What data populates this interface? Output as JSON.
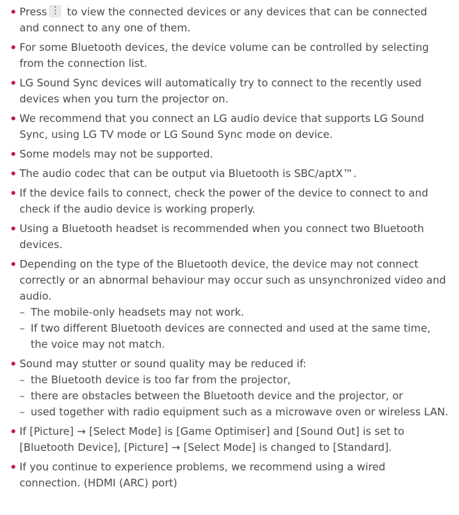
{
  "items": [
    {
      "pre": "Press",
      "icon": "more-vertical-icon",
      "post": " to view the connected devices or any devices that can be connected and connect to any one of them."
    },
    {
      "text": "For some Bluetooth devices, the device volume can be controlled by selecting from the connection list."
    },
    {
      "text": "LG Sound Sync devices will automatically try to connect to the recently used devices when you turn the projector on."
    },
    {
      "text": "We recommend that you connect an LG audio device that supports LG Sound Sync, using LG TV mode or LG Sound Sync mode on device."
    },
    {
      "text": "Some models may not be supported."
    },
    {
      "text": "The audio codec that can be output via Bluetooth is SBC/aptX™."
    },
    {
      "text": "If the device fails to connect, check the power of the device to connect to and check if the audio device is working properly."
    },
    {
      "text": "Using a Bluetooth headset is recommended when you connect two Bluetooth devices."
    },
    {
      "text": "Depending on the type of the Bluetooth device, the device may not connect correctly or an abnormal behaviour may occur such as unsynchronized video and audio.",
      "subs": [
        "The mobile-only headsets may not work.",
        "If two different Bluetooth devices are connected and used at the same time, the voice may not match."
      ]
    },
    {
      "text": "Sound may stutter or sound quality may be reduced if:",
      "subs": [
        "the Bluetooth device is too far from the projector,",
        "there are obstacles between the Bluetooth device and the projector, or",
        "used together with radio equipment such as a microwave oven or wireless LAN."
      ]
    },
    {
      "text": "If [Picture] → [Select Mode] is [Game Optimiser] and [Sound Out] is set to [Bluetooth Device], [Picture] → [Select Mode] is changed to [Standard]."
    },
    {
      "text": "If you continue to experience problems, we recommend using a wired connection. (HDMI (ARC) port)"
    }
  ]
}
